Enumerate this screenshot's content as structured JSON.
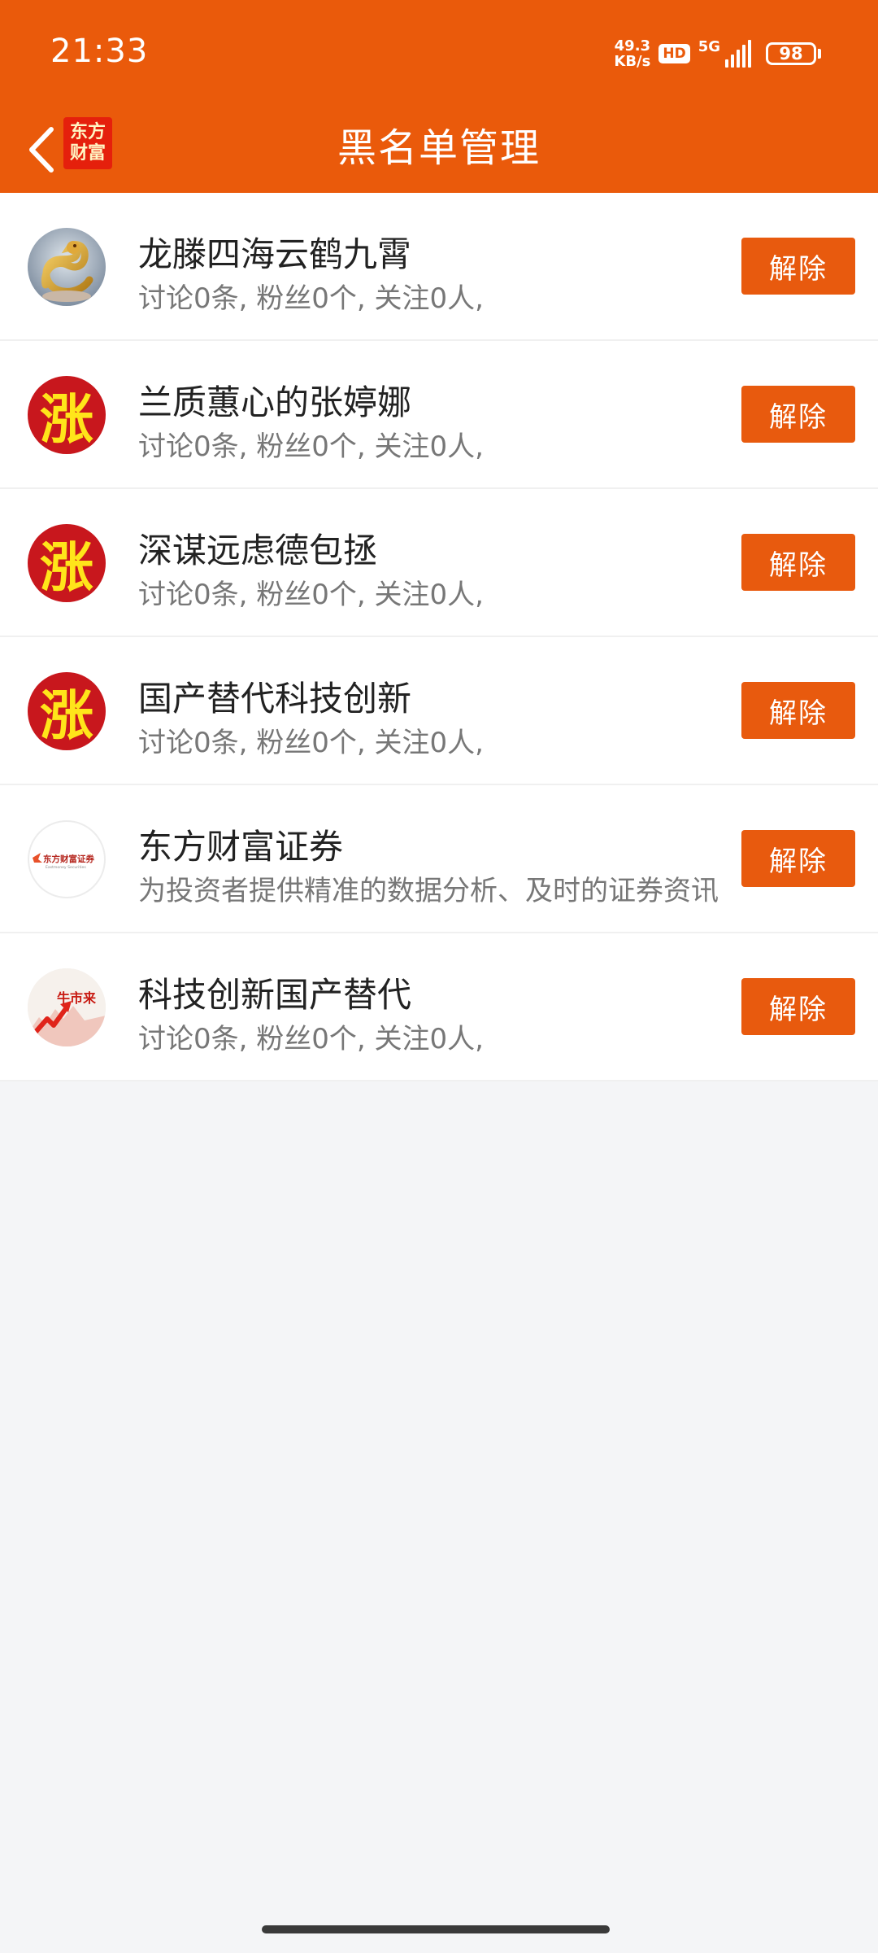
{
  "status_bar": {
    "time": "21:33",
    "net_speed_value": "49.3",
    "net_speed_unit": "KB/s",
    "hd_label": "HD",
    "network_label": "5G",
    "battery_level": "98"
  },
  "header": {
    "brand_line1": "东方",
    "brand_line2": "财富",
    "title": "黑名单管理"
  },
  "colors": {
    "accent": "#ea5a0b",
    "button": "#e85a0e",
    "zhang_avatar_bg": "#c8171d",
    "zhang_avatar_text": "#ffe51a"
  },
  "blocked_users": [
    {
      "name": "龙滕四海云鹤九霄",
      "stats": "讨论0条, 粉丝0个, 关注0人,",
      "button": "解除",
      "avatar": "dragon-avatar-icon"
    },
    {
      "name": "兰质蕙心的张婷娜",
      "stats": "讨论0条, 粉丝0个, 关注0人,",
      "button": "解除",
      "avatar": "zhang-avatar",
      "avatar_text": "涨"
    },
    {
      "name": "深谋远虑德包拯",
      "stats": "讨论0条, 粉丝0个, 关注0人,",
      "button": "解除",
      "avatar": "zhang-avatar",
      "avatar_text": "涨"
    },
    {
      "name": "国产替代科技创新",
      "stats": "讨论0条, 粉丝0个, 关注0人,",
      "button": "解除",
      "avatar": "zhang-avatar",
      "avatar_text": "涨"
    },
    {
      "name": "东方财富证券",
      "stats": "为投资者提供精准的数据分析、及时的证券资讯",
      "button": "解除",
      "avatar": "eastmoney-securities-logo",
      "avatar_text": "东方财富证券",
      "avatar_subtext": "Eastmoney Securities"
    },
    {
      "name": "科技创新国产替代",
      "stats": "讨论0条, 粉丝0个, 关注0人,",
      "button": "解除",
      "avatar": "bull-market-avatar-icon",
      "avatar_text": "牛市来"
    }
  ]
}
